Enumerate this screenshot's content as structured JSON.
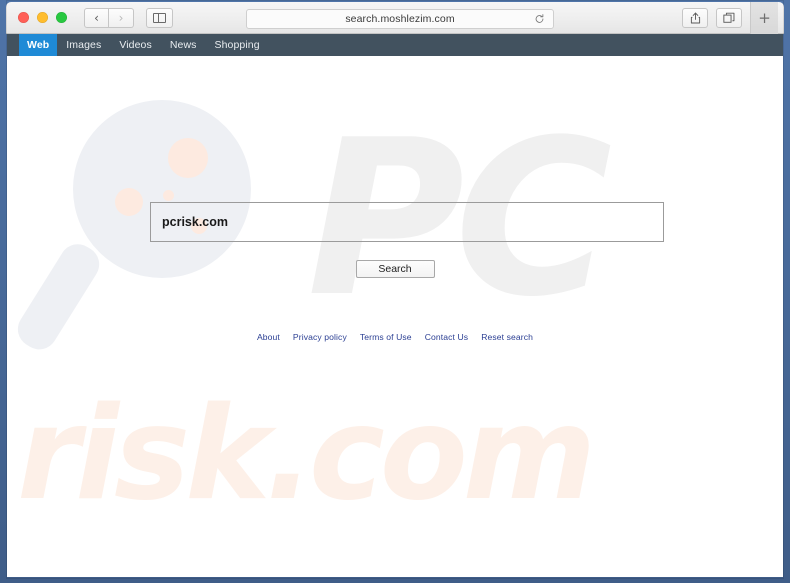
{
  "browser": {
    "traffic_lights": [
      {
        "name": "close",
        "color": "#ff5f57"
      },
      {
        "name": "minimize",
        "color": "#ffbd2e"
      },
      {
        "name": "maximize",
        "color": "#28c840"
      }
    ],
    "back_label": "‹",
    "forward_label": "›",
    "sidebar_icon": "sidebar-icon",
    "url": "search.moshlezim.com",
    "reload_icon": "reload-icon",
    "share_icon": "share-icon",
    "tabs_icon": "show-tabs-icon",
    "new_tab_label": "+"
  },
  "site_nav": {
    "items": [
      {
        "label": "Web",
        "active": true
      },
      {
        "label": "Images",
        "active": false
      },
      {
        "label": "Videos",
        "active": false
      },
      {
        "label": "News",
        "active": false
      },
      {
        "label": "Shopping",
        "active": false
      }
    ]
  },
  "search": {
    "query_value": "pcrisk.com",
    "placeholder": "",
    "button_label": "Search"
  },
  "footer": {
    "links": [
      {
        "label": "About"
      },
      {
        "label": "Privacy policy"
      },
      {
        "label": "Terms of Use"
      },
      {
        "label": "Contact Us"
      },
      {
        "label": "Reset search"
      }
    ]
  },
  "watermarks": {
    "pc_text": "PC",
    "risk_text": "risk.com",
    "magnifier_icon": "magnifier-watermark"
  },
  "colors": {
    "window_frame": "#4a6c9e",
    "nav_bar": "#42525f",
    "active_tab": "#1f8ad6",
    "link": "#2b3f93",
    "pc_watermark": "#f0f0f0",
    "risk_watermark": "#fdf0e8"
  }
}
